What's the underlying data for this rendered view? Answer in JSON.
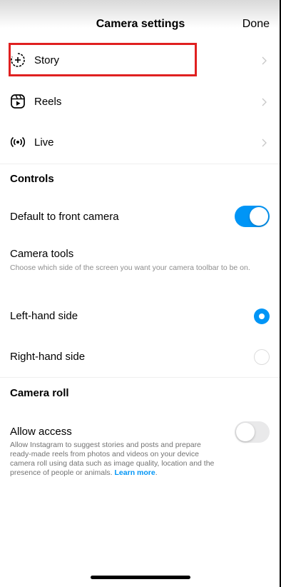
{
  "header": {
    "title": "Camera settings",
    "done_label": "Done"
  },
  "nav_items": [
    {
      "label": "Story",
      "icon": "story-add-icon"
    },
    {
      "label": "Reels",
      "icon": "reels-icon"
    },
    {
      "label": "Live",
      "icon": "live-broadcast-icon"
    }
  ],
  "controls": {
    "section_title": "Controls",
    "front_camera_label": "Default to front camera",
    "front_camera_on": true,
    "camera_tools_label": "Camera tools",
    "camera_tools_desc": "Choose which side of the screen you want your camera toolbar to be on.",
    "left_label": "Left-hand side",
    "right_label": "Right-hand side",
    "selected_side": "left"
  },
  "camera_roll": {
    "section_title": "Camera roll",
    "allow_access_label": "Allow access",
    "allow_access_on": false,
    "allow_access_desc": "Allow Instagram to suggest stories and posts and prepare ready-made reels from photos and videos on your device camera roll using data such as image quality, location and the presence of people or animals.",
    "learn_more": "Learn more",
    "after_link": "."
  },
  "colors": {
    "accent": "#0095f6",
    "highlight": "#e02020",
    "toggle_off": "#e9e9ea"
  }
}
